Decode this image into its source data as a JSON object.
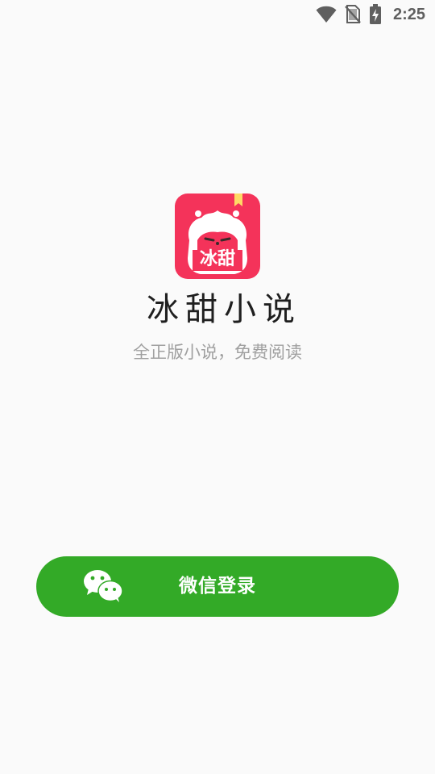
{
  "status_bar": {
    "time": "2:25",
    "icons": [
      "wifi-icon",
      "no-sim-icon",
      "battery-charging-icon"
    ]
  },
  "app": {
    "logo_icon": "app-logo-icon",
    "logo_text": "冰甜",
    "name": "冰甜小说",
    "slogan": "全正版小说，免费阅读"
  },
  "login": {
    "button_label": "微信登录",
    "icon": "wechat-icon",
    "button_color": "#33aa27"
  },
  "colors": {
    "background": "#fafafa",
    "logo_red": "#f4335a"
  }
}
